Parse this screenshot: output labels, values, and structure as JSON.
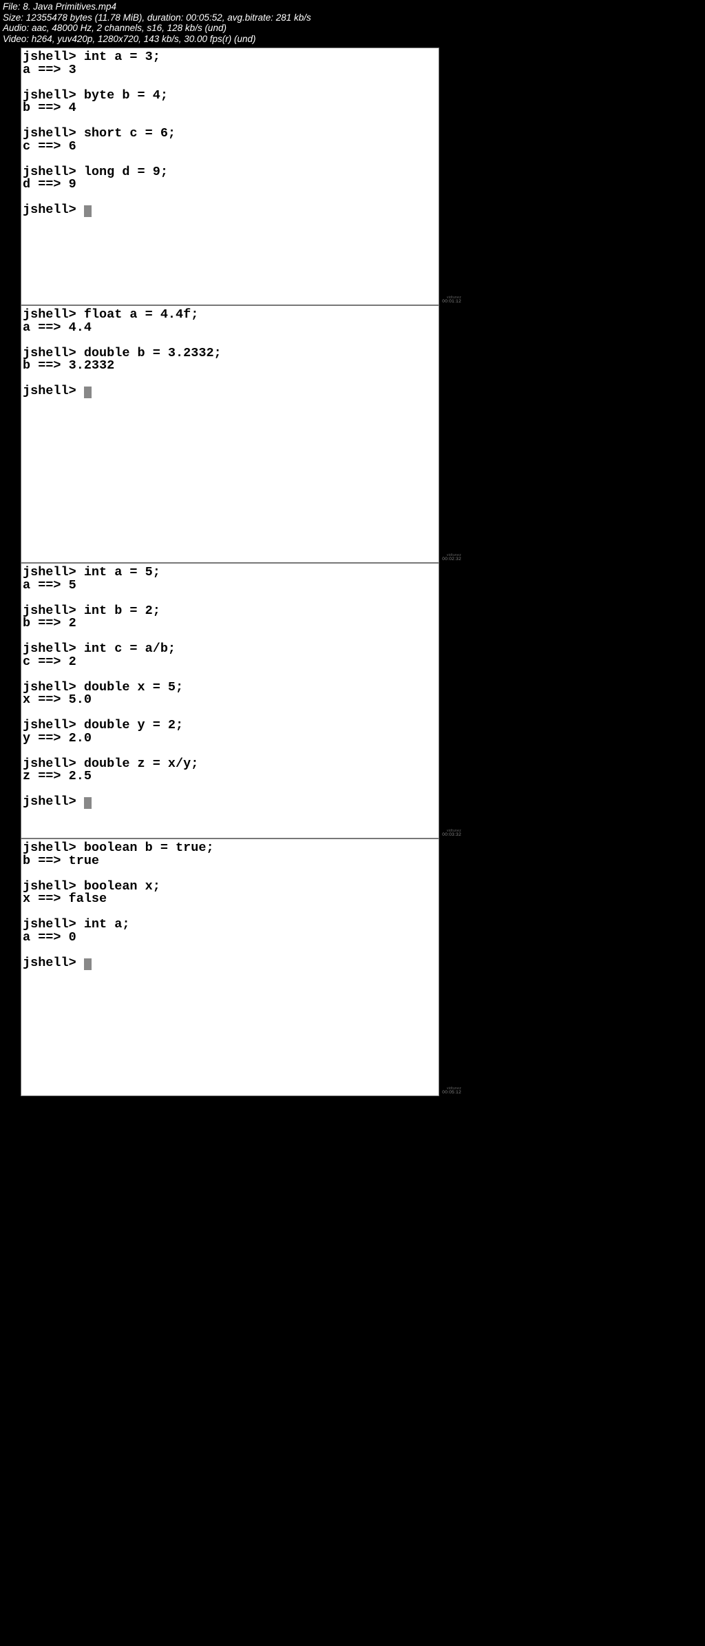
{
  "header": {
    "file": "File: 8. Java Primitives.mp4",
    "size": "Size: 12355478 bytes (11.78 MiB), duration: 00:05:52, avg.bitrate: 281 kb/s",
    "audio": "Audio: aac, 48000 Hz, 2 channels, s16, 128 kb/s (und)",
    "video": "Video: h264, yuv420p, 1280x720, 143 kb/s, 30.00 fps(r) (und)"
  },
  "frames": [
    {
      "id": "frame1",
      "height_class": "f1",
      "timestamp": "00:01:12",
      "lines": [
        "jshell> int a = 3;",
        "a ==> 3",
        "",
        "jshell> byte b = 4;",
        "b ==> 4",
        "",
        "jshell> short c = 6;",
        "c ==> 6",
        "",
        "jshell> long d = 9;",
        "d ==> 9",
        "",
        "jshell> "
      ]
    },
    {
      "id": "frame2",
      "height_class": "f2",
      "timestamp": "00:02:32",
      "lines": [
        "jshell> float a = 4.4f;",
        "a ==> 4.4",
        "",
        "jshell> double b = 3.2332;",
        "b ==> 3.2332",
        "",
        "jshell> "
      ]
    },
    {
      "id": "frame3",
      "height_class": "f3",
      "timestamp": "00:03:32",
      "lines": [
        "jshell> int a = 5;",
        "a ==> 5",
        "",
        "jshell> int b = 2;",
        "b ==> 2",
        "",
        "jshell> int c = a/b;",
        "c ==> 2",
        "",
        "jshell> double x = 5;",
        "x ==> 5.0",
        "",
        "jshell> double y = 2;",
        "y ==> 2.0",
        "",
        "jshell> double z = x/y;",
        "z ==> 2.5",
        "",
        "jshell> "
      ]
    },
    {
      "id": "frame4",
      "height_class": "f4",
      "timestamp": "00:05:12",
      "lines": [
        "jshell> boolean b = true;",
        "b ==> true",
        "",
        "jshell> boolean x;",
        "x ==> false",
        "",
        "jshell> int a;",
        "a ==> 0",
        "",
        "jshell> "
      ]
    }
  ],
  "watermark": "vidtunez"
}
